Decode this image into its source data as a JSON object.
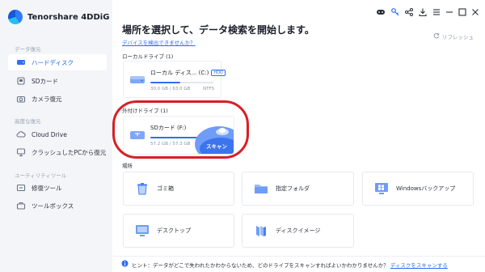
{
  "app": {
    "title": "Tenorshare 4DDiG"
  },
  "sidebar": {
    "sections": [
      {
        "header": "データ復元",
        "items": [
          {
            "label": "ハードディスク",
            "icon": "hard-disk-icon",
            "active": true
          },
          {
            "label": "SDカード",
            "icon": "sd-card-icon"
          },
          {
            "label": "カメラ復元",
            "icon": "camera-icon"
          }
        ]
      },
      {
        "header": "高度な復元",
        "items": [
          {
            "label": "Cloud Drive",
            "icon": "cloud-icon"
          },
          {
            "label": "クラッシュしたPCから復元",
            "icon": "crashed-pc-icon"
          }
        ]
      },
      {
        "header": "ユーティリティツール",
        "items": [
          {
            "label": "修復ツール",
            "icon": "repair-icon"
          },
          {
            "label": "ツールボックス",
            "icon": "toolbox-icon"
          }
        ]
      }
    ]
  },
  "main": {
    "title": "場所を選択して、データ検索を開始します。",
    "detect_link": "デバイスを検出できませんか？",
    "refresh_label": "リフレッシュ",
    "local_drives_label": "ローカルドライブ (1)",
    "local_drive": {
      "name": "ローカル ディス... (C:)",
      "badge": "HDD",
      "used": "30.0 GB / 63.0 GB",
      "fs": "NTFS",
      "usage_fraction": 0.48
    },
    "external_drives_label": "外付けドライブ (1)",
    "external_drive": {
      "name": "SDカード (F:)",
      "used": "57.2 GB / 57.3 GB",
      "usage_fraction": 0.99,
      "scan_label": "スキャン"
    },
    "places_label": "場所",
    "places": [
      {
        "label": "ゴミ箱",
        "icon": "recycle-bin-icon"
      },
      {
        "label": "指定フォルダ",
        "icon": "folder-icon"
      },
      {
        "label": "Windowsバックアップ",
        "icon": "windows-backup-icon"
      },
      {
        "label": "デスクトップ",
        "icon": "desktop-icon"
      },
      {
        "label": "ディスクイメージ",
        "icon": "disk-image-icon"
      }
    ],
    "hint_text": "ヒント：データがどこで失われたかわからないため、どのドライブをスキャンすればよいかわかりませんか？",
    "hint_link": "ディスクをスキャンする"
  },
  "colors": {
    "accent": "#2f6ff5",
    "highlight": "#d81f26",
    "sidebar_bg": "#f3f5f9"
  }
}
